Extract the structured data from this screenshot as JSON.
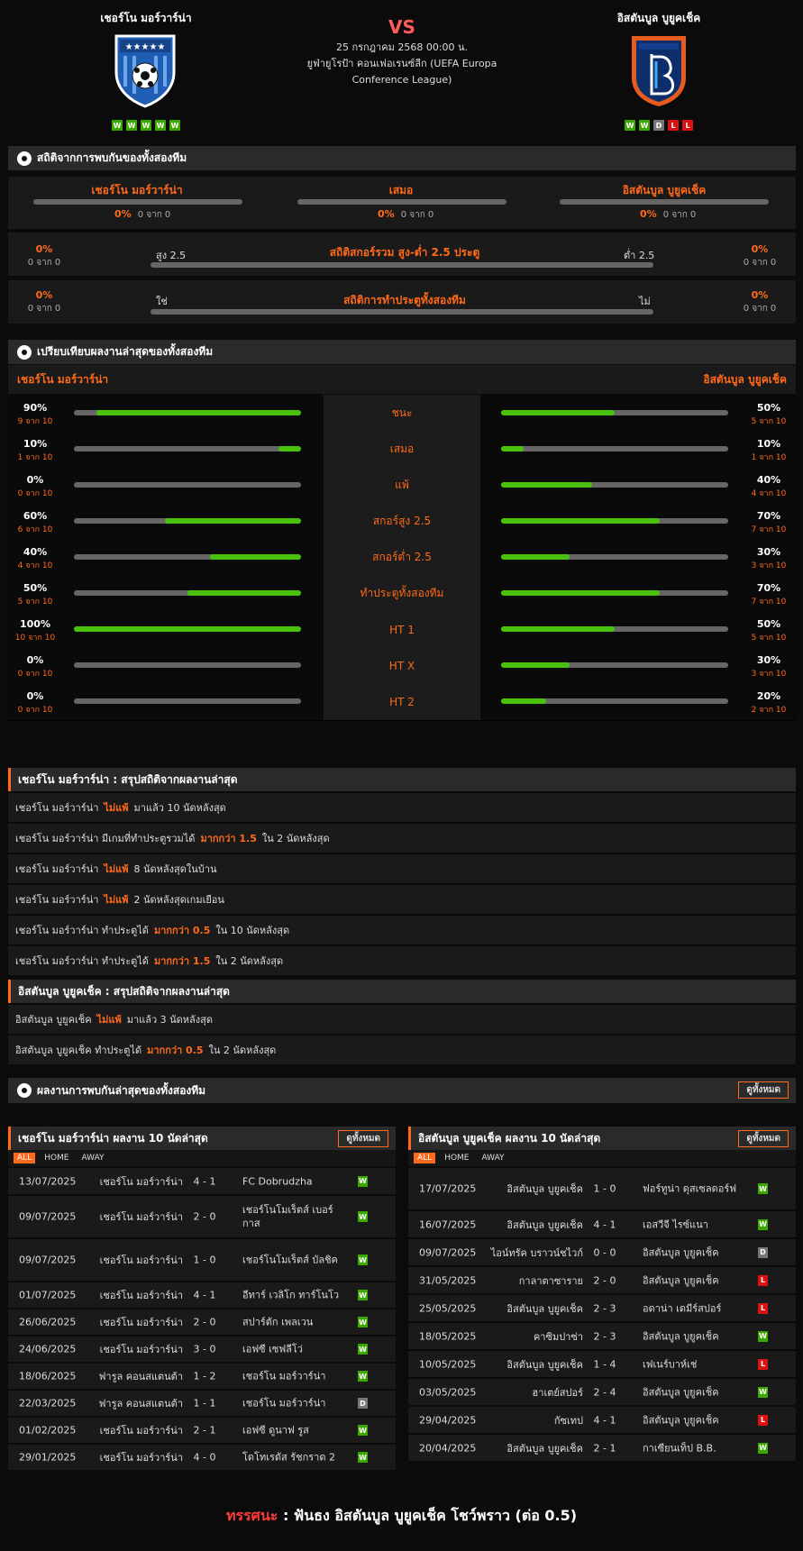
{
  "header": {
    "home": {
      "name": "เชอร์โน มอร์วาร์น่า",
      "form": [
        "W",
        "W",
        "W",
        "W",
        "W"
      ]
    },
    "away": {
      "name": "อิสตันบูล บูยูคเช็ค",
      "form": [
        "W",
        "W",
        "D",
        "L",
        "L"
      ]
    },
    "vs": "VS",
    "date": "25 กรกฎาคม 2568 00:00 น.",
    "competition": "ยูฟ่ายูโรป้า คอนเฟอเรนซ์ลีก (UEFA Europa Conference League)",
    "colors": {
      "accent": "#ff6a1a",
      "win": "#3ba800",
      "draw": "#777777",
      "loss": "#dd1111",
      "bar": "#49c20e"
    }
  },
  "h2h": {
    "title": "สถิติจากการพบกันของทั้งสองทีม",
    "cols": [
      {
        "label": "เชอร์โน มอร์วาร์น่า",
        "pct": "0%",
        "sub": "0 จาก 0",
        "value": 0
      },
      {
        "label": "เสมอ",
        "pct": "0%",
        "sub": "0 จาก 0",
        "value": 0
      },
      {
        "label": "อิสตันบูล บูยูคเช็ค",
        "pct": "0%",
        "sub": "0 จาก 0",
        "value": 0
      }
    ],
    "ou": {
      "title": "สถิติสกอร์รวม สูง-ต่ำ 2.5 ประตู",
      "left_label": "สูง 2.5",
      "right_label": "ต่ำ 2.5",
      "left_pct": "0%",
      "left_sub": "0 จาก 0",
      "right_pct": "0%",
      "right_sub": "0 จาก 0"
    },
    "btts": {
      "title": "สถิติการทำประตูทั้งสองทีม",
      "left_label": "ใช่",
      "right_label": "ไม่",
      "left_pct": "0%",
      "left_sub": "0 จาก 0",
      "right_pct": "0%",
      "right_sub": "0 จาก 0"
    }
  },
  "compare": {
    "title": "เปรียบเทียบผลงานล่าสุดของทั้งสองทีม",
    "home_label": "เชอร์โน มอร์วาร์น่า",
    "away_label": "อิสตันบูล บูยูคเช็ค",
    "rows": [
      {
        "label": "ชนะ",
        "home_pct": "90%",
        "home_sub": "9 จาก 10",
        "home_val": 0.9,
        "away_pct": "50%",
        "away_sub": "5 จาก 10",
        "away_val": 0.5
      },
      {
        "label": "เสมอ",
        "home_pct": "10%",
        "home_sub": "1 จาก 10",
        "home_val": 0.1,
        "away_pct": "10%",
        "away_sub": "1 จาก 10",
        "away_val": 0.1
      },
      {
        "label": "แพ้",
        "home_pct": "0%",
        "home_sub": "0 จาก 10",
        "home_val": 0,
        "away_pct": "40%",
        "away_sub": "4 จาก 10",
        "away_val": 0.4
      },
      {
        "label": "สกอร์สูง 2.5",
        "home_pct": "60%",
        "home_sub": "6 จาก 10",
        "home_val": 0.6,
        "away_pct": "70%",
        "away_sub": "7 จาก 10",
        "away_val": 0.7
      },
      {
        "label": "สกอร์ต่ำ 2.5",
        "home_pct": "40%",
        "home_sub": "4 จาก 10",
        "home_val": 0.4,
        "away_pct": "30%",
        "away_sub": "3 จาก 10",
        "away_val": 0.3
      },
      {
        "label": "ทำประตูทั้งสองทีม",
        "home_pct": "50%",
        "home_sub": "5 จาก 10",
        "home_val": 0.5,
        "away_pct": "70%",
        "away_sub": "7 จาก 10",
        "away_val": 0.7
      },
      {
        "label": "HT 1",
        "home_pct": "100%",
        "home_sub": "10 จาก 10",
        "home_val": 1.0,
        "away_pct": "50%",
        "away_sub": "5 จาก 10",
        "away_val": 0.5
      },
      {
        "label": "HT X",
        "home_pct": "0%",
        "home_sub": "0 จาก 10",
        "home_val": 0,
        "away_pct": "30%",
        "away_sub": "3 จาก 10",
        "away_val": 0.3
      },
      {
        "label": "HT 2",
        "home_pct": "0%",
        "home_sub": "0 จาก 10",
        "home_val": 0,
        "away_pct": "20%",
        "away_sub": "2 จาก 10",
        "away_val": 0.2
      }
    ]
  },
  "summary_home": {
    "title": "เชอร์โน มอร์วาร์น่า : สรุปสถิติจากผลงานล่าสุด",
    "rows": [
      {
        "a": "เชอร์โน มอร์วาร์น่า",
        "hl": "ไม่แพ้",
        "b": "มาแล้ว 10 นัดหลังสุด"
      },
      {
        "a": "เชอร์โน มอร์วาร์น่า มีเกมที่ทำประตูรวมได้",
        "hl": "มากกว่า 1.5",
        "b": "ใน 2 นัดหลังสุด"
      },
      {
        "a": "เชอร์โน มอร์วาร์น่า",
        "hl": "ไม่แพ้",
        "b": "8 นัดหลังสุดในบ้าน"
      },
      {
        "a": "เชอร์โน มอร์วาร์น่า",
        "hl": "ไม่แพ้",
        "b": "2 นัดหลังสุดเกมเยือน"
      },
      {
        "a": "เชอร์โน มอร์วาร์น่า ทำประตูได้",
        "hl": "มากกว่า 0.5",
        "b": "ใน 10 นัดหลังสุด"
      },
      {
        "a": "เชอร์โน มอร์วาร์น่า ทำประตูได้",
        "hl": "มากกว่า 1.5",
        "b": "ใน 2 นัดหลังสุด"
      }
    ]
  },
  "summary_away": {
    "title": "อิสตันบูล บูยูคเช็ค : สรุปสถิติจากผลงานล่าสุด",
    "rows": [
      {
        "a": "อิสตันบูล บูยูคเช็ค",
        "hl": "ไม่แพ้",
        "b": "มาแล้ว 3 นัดหลังสุด"
      },
      {
        "a": "อิสตันบูล บูยูคเช็ค ทำประตูได้",
        "hl": "มากกว่า 0.5",
        "b": "ใน 2 นัดหลังสุด"
      }
    ]
  },
  "recent_h2h": {
    "title": "ผลงานการพบกันล่าสุดของทั้งสองทีม",
    "view_all": "ดูทั้งหมด"
  },
  "home_results": {
    "title": "เชอร์โน มอร์วาร์น่า ผลงาน 10 นัดล่าสุด",
    "view_all": "ดูทั้งหมด",
    "tabs": [
      "ALL",
      "HOME",
      "AWAY"
    ],
    "rows": [
      {
        "date": "13/07/2025",
        "home": "เชอร์โน มอร์วาร์น่า",
        "score": "4 - 1",
        "away": "FC Dobrudzha",
        "res": "W"
      },
      {
        "date": "09/07/2025",
        "home": "เชอร์โน มอร์วาร์น่า",
        "score": "2 - 0",
        "away": "เชอร์โนโมเร็ตส์ เบอร์กาส",
        "res": "W"
      },
      {
        "date": "09/07/2025",
        "home": "เชอร์โน มอร์วาร์น่า",
        "score": "1 - 0",
        "away": "เชอร์โนโมเร็ตส์ บัลชิค",
        "res": "W"
      },
      {
        "date": "01/07/2025",
        "home": "เชอร์โน มอร์วาร์น่า",
        "score": "4 - 1",
        "away": "อีทาร์ เวลิโก ทาร์โนโว",
        "res": "W"
      },
      {
        "date": "26/06/2025",
        "home": "เชอร์โน มอร์วาร์น่า",
        "score": "2 - 0",
        "away": "สปาร์ตัก เพลเวน",
        "res": "W"
      },
      {
        "date": "24/06/2025",
        "home": "เชอร์โน มอร์วาร์น่า",
        "score": "3 - 0",
        "away": "เอฟซี เซฟลีโว่",
        "res": "W"
      },
      {
        "date": "18/06/2025",
        "home": "ฟารูล คอนสแตนต้า",
        "score": "1 - 2",
        "away": "เชอร์โน มอร์วาร์น่า",
        "res": "W"
      },
      {
        "date": "22/03/2025",
        "home": "ฟารูล คอนสแตนต้า",
        "score": "1 - 1",
        "away": "เชอร์โน มอร์วาร์น่า",
        "res": "D"
      },
      {
        "date": "01/02/2025",
        "home": "เชอร์โน มอร์วาร์น่า",
        "score": "2 - 1",
        "away": "เอฟซี ดูนาฟ รูส",
        "res": "W"
      },
      {
        "date": "29/01/2025",
        "home": "เชอร์โน มอร์วาร์น่า",
        "score": "4 - 0",
        "away": "โดโทเรดัส รัชกราด 2",
        "res": "W"
      }
    ]
  },
  "away_results": {
    "title": "อิสตันบูล บูยูคเช็ค ผลงาน 10 นัดล่าสุด",
    "view_all": "ดูทั้งหมด",
    "tabs": [
      "ALL",
      "HOME",
      "AWAY"
    ],
    "rows": [
      {
        "date": "17/07/2025",
        "home": "อิสตันบูล บูยูคเช็ค",
        "score": "1 - 0",
        "away": "ฟอร์ทูน่า ดุสเซลดอร์ฟ",
        "res": "W"
      },
      {
        "date": "16/07/2025",
        "home": "อิสตันบูล บูยูคเช็ค",
        "score": "4 - 1",
        "away": "เอสวีจี ไรซ์แนา",
        "res": "W"
      },
      {
        "date": "09/07/2025",
        "home": "ไอน์ทรัค บราวน์ชไวก์",
        "score": "0 - 0",
        "away": "อิสตันบูล บูยูคเช็ค",
        "res": "D"
      },
      {
        "date": "31/05/2025",
        "home": "กาลาตาซาราย",
        "score": "2 - 0",
        "away": "อิสตันบูล บูยูคเช็ค",
        "res": "L"
      },
      {
        "date": "25/05/2025",
        "home": "อิสตันบูล บูยูคเช็ค",
        "score": "2 - 3",
        "away": "อดาน่า เดมีร์สปอร์",
        "res": "L"
      },
      {
        "date": "18/05/2025",
        "home": "คาซิมปาซ่า",
        "score": "2 - 3",
        "away": "อิสตันบูล บูยูคเช็ค",
        "res": "W"
      },
      {
        "date": "10/05/2025",
        "home": "อิสตันบูล บูยูคเช็ค",
        "score": "1 - 4",
        "away": "เฟเนร์บาห์เช่",
        "res": "L"
      },
      {
        "date": "03/05/2025",
        "home": "ฮาเตย์สปอร์",
        "score": "2 - 4",
        "away": "อิสตันบูล บูยูคเช็ค",
        "res": "W"
      },
      {
        "date": "29/04/2025",
        "home": "กัซเทป",
        "score": "4 - 1",
        "away": "อิสตันบูล บูยูคเช็ค",
        "res": "L"
      },
      {
        "date": "20/04/2025",
        "home": "อิสตันบูล บูยูคเช็ค",
        "score": "2 - 1",
        "away": "กาเซียนเท็ป B.B.",
        "res": "W"
      }
    ]
  },
  "prediction": {
    "label": "ทรรศนะ",
    "colon": ":",
    "text": "ฟันธง อิสตันบูล บูยูคเช็ค โชว์พราว (ต่อ 0.5)"
  }
}
